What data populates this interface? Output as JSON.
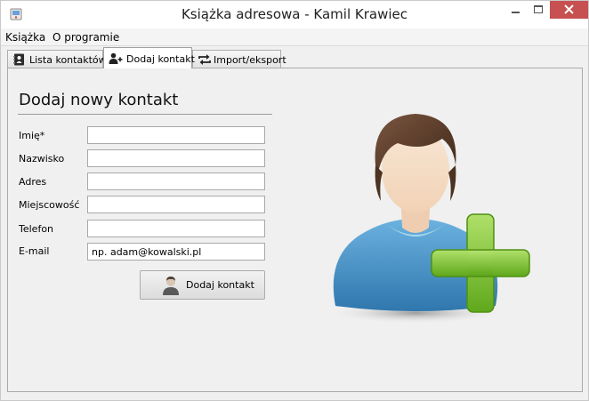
{
  "window": {
    "title": "Książka adresowa - Kamil Krawiec"
  },
  "menu": {
    "items": [
      {
        "label": "Książka"
      },
      {
        "label": "O programie"
      }
    ]
  },
  "tabs": [
    {
      "label": "Lista kontaktów",
      "icon": "address-book-icon",
      "active": false
    },
    {
      "label": "Dodaj kontakt",
      "icon": "add-user-icon",
      "active": true
    },
    {
      "label": "Import/eksport",
      "icon": "sync-arrows-icon",
      "active": false
    }
  ],
  "form": {
    "heading": "Dodaj nowy kontakt",
    "fields": [
      {
        "label": "Imię*",
        "value": "",
        "placeholder": ""
      },
      {
        "label": "Nazwisko",
        "value": "",
        "placeholder": ""
      },
      {
        "label": "Adres",
        "value": "",
        "placeholder": ""
      },
      {
        "label": "Miejscowość",
        "value": "",
        "placeholder": ""
      },
      {
        "label": "Telefon",
        "value": "",
        "placeholder": ""
      },
      {
        "label": "E-mail",
        "value": "",
        "placeholder": "np. adam@kowalski.pl"
      }
    ],
    "submit_label": "Dodaj kontakt"
  },
  "colors": {
    "close_button": "#c75050",
    "shirt_blue": "#3f8fc6",
    "plus_green": "#7cc12c"
  }
}
